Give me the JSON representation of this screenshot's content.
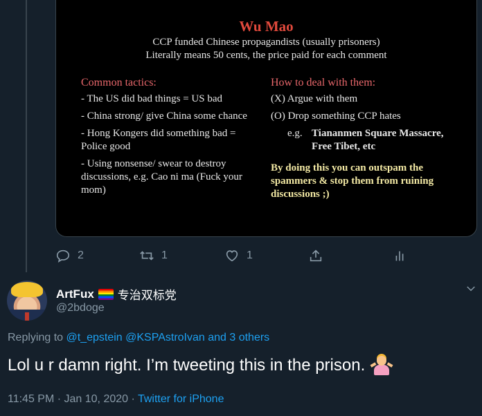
{
  "card": {
    "title": "Wu Mao",
    "subtitle_1": "CCP funded Chinese propagandists (usually prisoners)",
    "subtitle_2": "Literally means 50 cents, the price paid for each comment",
    "left_heading": "Common tactics:",
    "left_items": [
      "- The US did bad things = US bad",
      "- China strong/ give China some chance",
      "- Hong Kongers did something bad = Police good",
      "- Using nonsense/ swear to destroy discussions, e.g. Cao ni ma (Fuck your mom)"
    ],
    "right_heading": "How to deal with them:",
    "right_items": [
      "(X) Argue with them",
      "(O) Drop something CCP hates"
    ],
    "eg_label": "e.g.",
    "eg_text": "Tiananmen Square Massacre, Free Tibet, etc",
    "right_conclusion": "By doing this you can outspam the spammers & stop them from ruining discussions ;)"
  },
  "parent_actions": {
    "reply_count": "2",
    "retweet_count": "1",
    "like_count": "1"
  },
  "reply": {
    "display_name": "ArtFux",
    "name_suffix": "专治双标党",
    "handle": "@2bdoge",
    "replying_prefix": "Replying to",
    "replying_to": "@t_epstein @KSPAstroIvan and 3 others",
    "text": "Lol u r damn right. I’m tweeting this in the prison.",
    "time": "11:45 PM · Jan 10, 2020 ·",
    "source": "Twitter for iPhone"
  },
  "colors": {
    "background": "#15202b",
    "accent": "#1da1f2",
    "muted": "#8899a6",
    "slide_title": "#e0493c",
    "slide_highlight": "#f3e9a4"
  },
  "icons": [
    "reply-icon",
    "retweet-icon",
    "like-icon",
    "share-icon",
    "analytics-icon",
    "chevron-down-icon",
    "rainbow-flag-icon",
    "person-shrugging-icon"
  ]
}
